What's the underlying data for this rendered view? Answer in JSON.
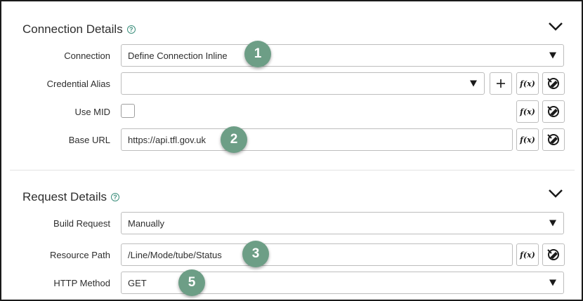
{
  "connection_details": {
    "title": "Connection Details",
    "rows": {
      "connection": {
        "label": "Connection",
        "value": "Define Connection Inline"
      },
      "credential_alias": {
        "label": "Credential Alias",
        "value": ""
      },
      "use_mid": {
        "label": "Use MID",
        "checked": false
      },
      "base_url": {
        "label": "Base URL",
        "value": "https://api.tfl.gov.uk"
      }
    }
  },
  "request_details": {
    "title": "Request Details",
    "rows": {
      "build_request": {
        "label": "Build Request",
        "value": "Manually"
      },
      "resource_path": {
        "label": "Resource Path",
        "value": "/Line/Mode/tube/Status"
      },
      "http_method": {
        "label": "HTTP Method",
        "value": "GET"
      }
    }
  },
  "icons": {
    "help": "question-circle-icon",
    "collapse": "chevron-down-icon",
    "dropdown": "caret-down-icon",
    "add": "plus-icon",
    "function": "function-fx-icon",
    "data_pill": "data-pill-picker-icon"
  },
  "common": {
    "fx_symbol": "f(x)",
    "plus_symbol": "+",
    "help_symbol": "?"
  },
  "callouts": [
    "1",
    "2",
    "3",
    "5"
  ],
  "colors": {
    "callout_bg": "#6d9e86",
    "help_accent": "#3c8f7c",
    "border": "#bdbdbd"
  }
}
